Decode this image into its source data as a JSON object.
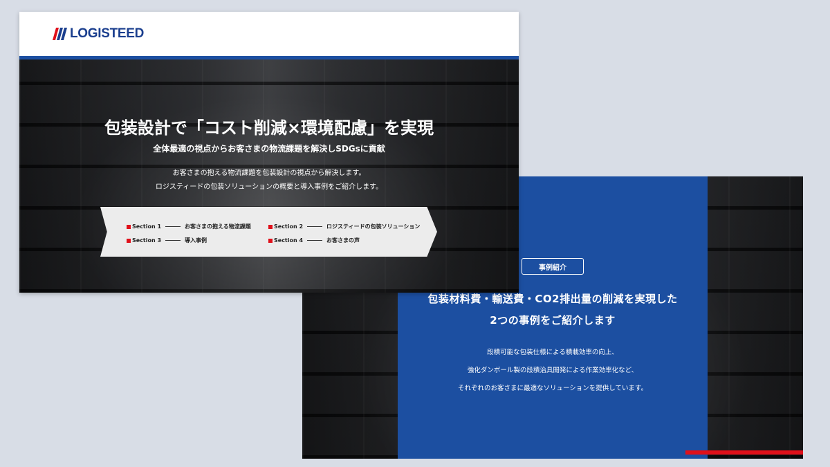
{
  "slide1": {
    "logo_text": "LOGISTEED",
    "title": "包装設計で「コスト削減×環境配慮」を実現",
    "subtitle": "全体最適の視点からお客さまの物流課題を解決しSDGsに貢献",
    "description": [
      "お客さまの抱える物流課題を包装設計の視点から解決します。",
      "ロジスティードの包装ソリューションの概要と導入事例をご紹介します。"
    ],
    "sections": [
      {
        "label": "Section 1",
        "title": "お客さまの抱える物流課題"
      },
      {
        "label": "Section 2",
        "title": "ロジスティードの包装ソリューション"
      },
      {
        "label": "Section 3",
        "title": "導入事例"
      },
      {
        "label": "Section 4",
        "title": "お客さまの声"
      }
    ]
  },
  "slide2": {
    "tag": "事例紹介",
    "title": [
      "包装材料費・輸送費・CO2排出量の削減を実現した",
      "2つの事例をご紹介します"
    ],
    "body": [
      "段積可能な包装仕様による積載効率の向上、",
      "強化ダンボール製の段積治具開発による作業効率化など、",
      "それぞれのお客さまに最適なソリューションを提供しています。"
    ]
  },
  "colors": {
    "brand_blue": "#1c4fa1",
    "accent_red": "#e0101a",
    "background": "#d8dde6"
  }
}
